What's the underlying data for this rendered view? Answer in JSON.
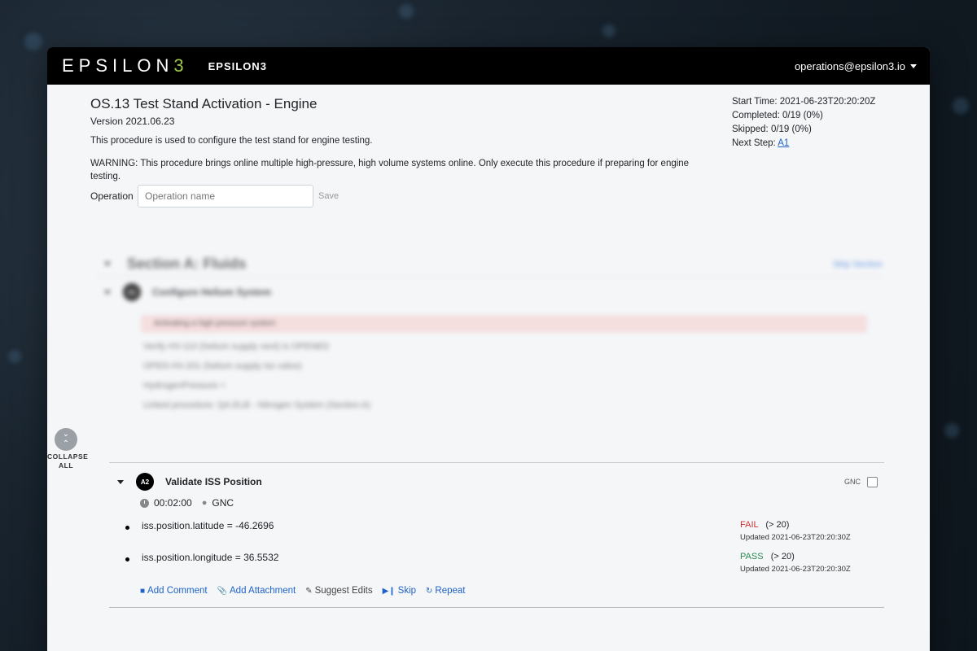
{
  "navbar": {
    "logo_text": "EPSILON",
    "logo_mark": "3",
    "brand": "EPSILON3",
    "user_email": "operations@epsilon3.io"
  },
  "procedure": {
    "title": "OS.13 Test Stand Activation - Engine",
    "version": "Version 2021.06.23",
    "description": "This procedure is used to configure the test stand for engine testing.",
    "warning": "WARNING: This procedure brings online multiple high-pressure, high volume systems online. Only execute this procedure if preparing for engine testing.",
    "operation_label": "Operation",
    "operation_placeholder": "Operation name",
    "save_label": "Save"
  },
  "status": {
    "start_time": "Start Time: 2021-06-23T20:20:20Z",
    "completed": "Completed: 0/19 (0%)",
    "skipped": "Skipped: 0/19 (0%)",
    "next_step_label": "Next Step: ",
    "next_step_link": "A1"
  },
  "section_a": {
    "title": "Section A: Fluids",
    "skip_label": "Skip Section",
    "step_a1_title": "Configure Helium System",
    "warning_text": "Activating a high pressure system",
    "lines": [
      "Verify HV-110 (helium supply vent) is OPENED",
      "OPEN HV-201 (helium supply iso valve)",
      "HydrogenPressure =",
      "Linked procedure: QA.ELB - Nitrogen System (Section A)"
    ]
  },
  "collapse": {
    "label": "COLLAPSE ALL",
    "icon": "chevron-collapse-icon"
  },
  "step_a2": {
    "badge": "A2",
    "title": "Validate ISS Position",
    "role": "GNC",
    "duration": "00:02:00",
    "assignee": "GNC",
    "items": [
      {
        "text": "iss.position.latitude = -46.2696",
        "result": "FAIL",
        "rule": "(> 20)",
        "updated": "Updated 2021-06-23T20:20:30Z"
      },
      {
        "text": "iss.position.longitude = 36.5532",
        "result": "PASS",
        "rule": "(> 20)",
        "updated": "Updated 2021-06-23T20:20:30Z"
      }
    ],
    "actions": {
      "add_comment": "Add Comment",
      "add_attachment": "Add Attachment",
      "suggest_edits": "Suggest Edits",
      "skip": "Skip",
      "repeat": "Repeat"
    }
  },
  "colors": {
    "link": "#1e62c9",
    "fail": "#cc3333",
    "pass": "#2a8a50",
    "logo_accent": "#9ec84a"
  }
}
